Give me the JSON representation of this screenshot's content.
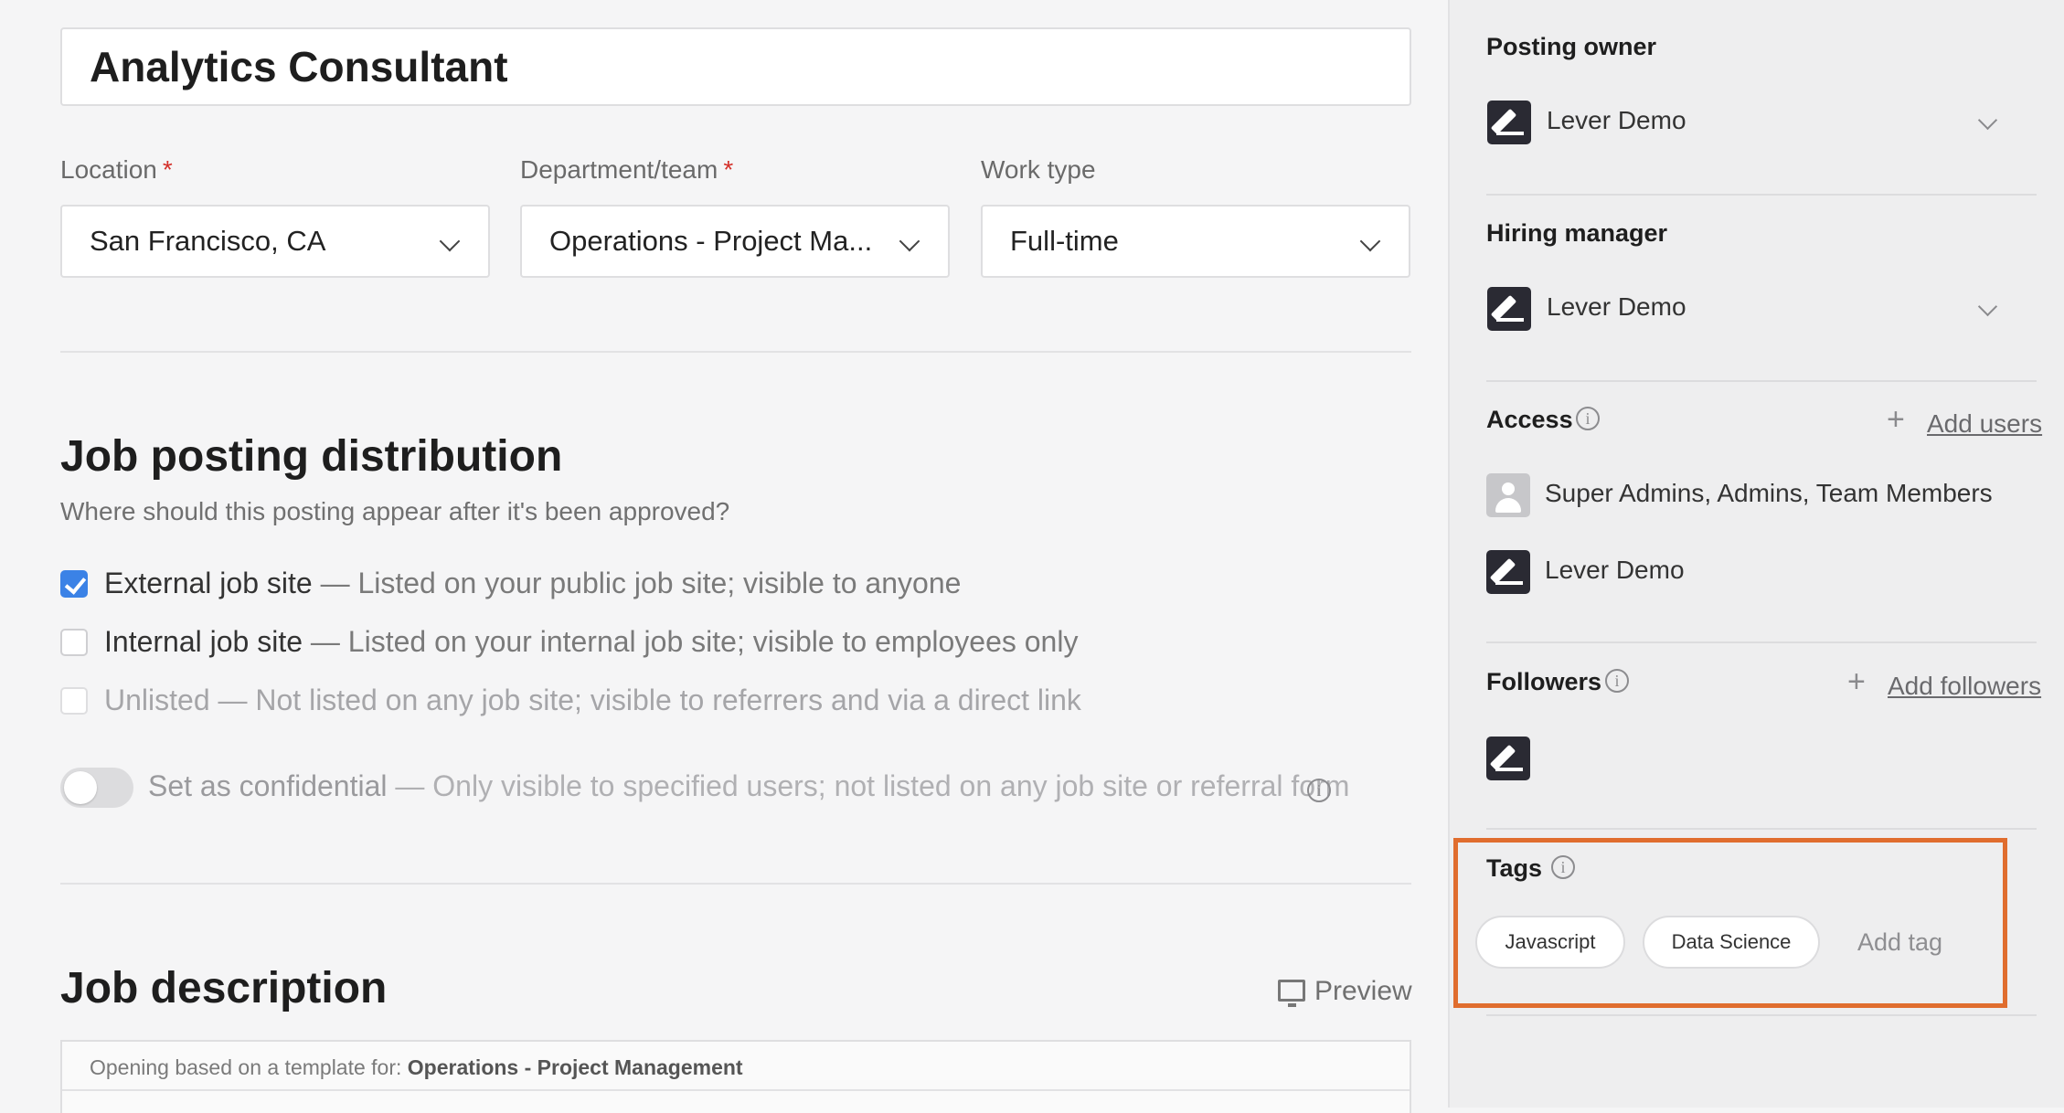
{
  "posting": {
    "title": "Analytics Consultant"
  },
  "fields": {
    "location": {
      "label": "Location",
      "required_mark": "*",
      "value": "San Francisco, CA"
    },
    "department": {
      "label": "Department/team",
      "required_mark": "*",
      "value": "Operations - Project Ma..."
    },
    "work_type": {
      "label": "Work type",
      "value": "Full-time"
    }
  },
  "distribution": {
    "heading": "Job posting distribution",
    "subtitle": "Where should this posting appear after it's been approved?",
    "options": [
      {
        "name": "External job site",
        "desc": " — Listed on your public job site; visible to anyone",
        "checked": true
      },
      {
        "name": "Internal job site",
        "desc": " — Listed on your internal job site; visible to employees only",
        "checked": false
      },
      {
        "name": "Unlisted",
        "desc": " — Not listed on any job site; visible to referrers and via a direct link",
        "checked": false
      }
    ],
    "confidential": {
      "name": "Set as confidential",
      "desc": " — Only visible to specified users; not listed on any job site or referral form",
      "enabled": false
    }
  },
  "job_description": {
    "heading": "Job description",
    "preview_label": "Preview",
    "template_prefix": "Opening based on a template for: ",
    "template_name": "Operations - Project Management"
  },
  "sidebar": {
    "posting_owner": {
      "heading": "Posting owner",
      "name": "Lever Demo"
    },
    "hiring_manager": {
      "heading": "Hiring manager",
      "name": "Lever Demo"
    },
    "access": {
      "heading": "Access",
      "add_label": "Add users",
      "entries": [
        "Super Admins, Admins, Team Members",
        "Lever Demo"
      ]
    },
    "followers": {
      "heading": "Followers",
      "add_label": "Add followers"
    },
    "tags": {
      "heading": "Tags",
      "items": [
        "Javascript",
        "Data Science"
      ],
      "add_label": "Add tag"
    }
  },
  "colors": {
    "accent_blue": "#3b82e6",
    "required_red": "#d4302a",
    "highlight_orange": "#e06d2e"
  }
}
